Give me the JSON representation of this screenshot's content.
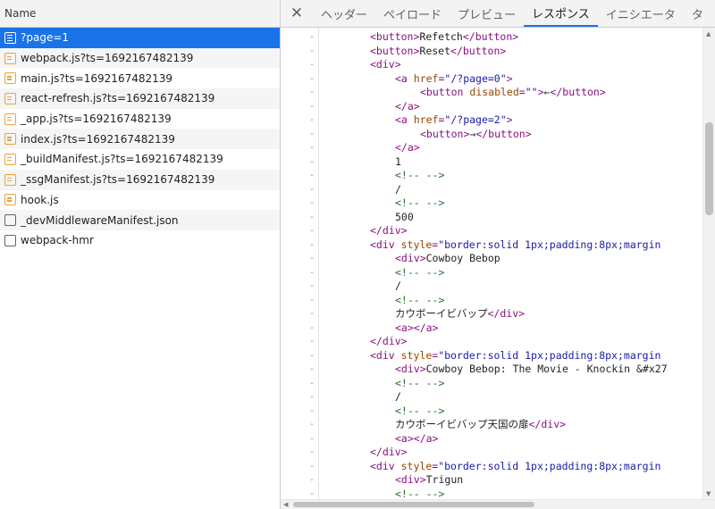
{
  "network": {
    "name_header": "Name",
    "requests": [
      {
        "label": "?page=1",
        "icon": "document-icon",
        "selected": true
      },
      {
        "label": "webpack.js?ts=1692167482139",
        "icon": "script-icon",
        "selected": false
      },
      {
        "label": "main.js?ts=1692167482139",
        "icon": "script-icon",
        "selected": false
      },
      {
        "label": "react-refresh.js?ts=1692167482139",
        "icon": "script-icon",
        "selected": false
      },
      {
        "label": "_app.js?ts=1692167482139",
        "icon": "script-icon",
        "selected": false
      },
      {
        "label": "index.js?ts=1692167482139",
        "icon": "script-icon",
        "selected": false
      },
      {
        "label": "_buildManifest.js?ts=1692167482139",
        "icon": "script-icon",
        "selected": false
      },
      {
        "label": "_ssgManifest.js?ts=1692167482139",
        "icon": "script-icon",
        "selected": false
      },
      {
        "label": "hook.js",
        "icon": "script-icon",
        "selected": false
      },
      {
        "label": "_devMiddlewareManifest.json",
        "icon": "file-icon",
        "selected": false
      },
      {
        "label": "webpack-hmr",
        "icon": "file-icon",
        "selected": false
      }
    ]
  },
  "tabs": {
    "close_glyph": "✕",
    "items": [
      {
        "label": "ヘッダー",
        "active": false
      },
      {
        "label": "ペイロード",
        "active": false
      },
      {
        "label": "プレビュー",
        "active": false
      },
      {
        "label": "レスポンス",
        "active": true
      },
      {
        "label": "イニシエータ",
        "active": false
      },
      {
        "label": "タ",
        "active": false
      }
    ]
  },
  "response": {
    "gutter_mark": "-",
    "lines": [
      {
        "indent": 8,
        "parts": [
          [
            "tag",
            "<button>"
          ],
          [
            "text",
            "Refetch"
          ],
          [
            "tag",
            "</button>"
          ]
        ]
      },
      {
        "indent": 8,
        "parts": [
          [
            "tag",
            "<button>"
          ],
          [
            "text",
            "Reset"
          ],
          [
            "tag",
            "</button>"
          ]
        ]
      },
      {
        "indent": 8,
        "parts": [
          [
            "tag",
            "<div>"
          ]
        ]
      },
      {
        "indent": 12,
        "parts": [
          [
            "tag",
            "<a "
          ],
          [
            "attr",
            "href"
          ],
          [
            "tag",
            "="
          ],
          [
            "val",
            "\"/?page=0\""
          ],
          [
            "tag",
            ">"
          ]
        ]
      },
      {
        "indent": 16,
        "parts": [
          [
            "tag",
            "<button "
          ],
          [
            "attr",
            "disabled"
          ],
          [
            "tag",
            "="
          ],
          [
            "val",
            "\"\""
          ],
          [
            "tag",
            ">"
          ],
          [
            "text",
            "←"
          ],
          [
            "tag",
            "</button>"
          ]
        ]
      },
      {
        "indent": 12,
        "parts": [
          [
            "tag",
            "</a>"
          ]
        ]
      },
      {
        "indent": 12,
        "parts": [
          [
            "tag",
            "<a "
          ],
          [
            "attr",
            "href"
          ],
          [
            "tag",
            "="
          ],
          [
            "val",
            "\"/?page=2\""
          ],
          [
            "tag",
            ">"
          ]
        ]
      },
      {
        "indent": 16,
        "parts": [
          [
            "tag",
            "<button>"
          ],
          [
            "text",
            "→"
          ],
          [
            "tag",
            "</button>"
          ]
        ]
      },
      {
        "indent": 12,
        "parts": [
          [
            "tag",
            "</a>"
          ]
        ]
      },
      {
        "indent": 12,
        "parts": [
          [
            "text",
            "1"
          ]
        ]
      },
      {
        "indent": 12,
        "parts": [
          [
            "comment",
            "<!-- -->"
          ]
        ]
      },
      {
        "indent": 12,
        "parts": [
          [
            "text",
            "/"
          ]
        ]
      },
      {
        "indent": 12,
        "parts": [
          [
            "comment",
            "<!-- -->"
          ]
        ]
      },
      {
        "indent": 12,
        "parts": [
          [
            "text",
            "500"
          ]
        ]
      },
      {
        "indent": 8,
        "parts": [
          [
            "tag",
            "</div>"
          ]
        ]
      },
      {
        "indent": 8,
        "parts": [
          [
            "tag",
            "<div "
          ],
          [
            "attr",
            "style"
          ],
          [
            "tag",
            "="
          ],
          [
            "val",
            "\"border:solid 1px;padding:8px;margin"
          ]
        ]
      },
      {
        "indent": 12,
        "parts": [
          [
            "tag",
            "<div>"
          ],
          [
            "text",
            "Cowboy Bebop"
          ]
        ]
      },
      {
        "indent": 12,
        "parts": [
          [
            "comment",
            "<!-- -->"
          ]
        ]
      },
      {
        "indent": 12,
        "parts": [
          [
            "text",
            "/"
          ]
        ]
      },
      {
        "indent": 12,
        "parts": [
          [
            "comment",
            "<!-- -->"
          ]
        ]
      },
      {
        "indent": 12,
        "parts": [
          [
            "text",
            "カウボーイビバップ"
          ],
          [
            "tag",
            "</div>"
          ]
        ]
      },
      {
        "indent": 12,
        "parts": [
          [
            "tag",
            "<a>"
          ],
          [
            "tag",
            "</a>"
          ]
        ]
      },
      {
        "indent": 8,
        "parts": [
          [
            "tag",
            "</div>"
          ]
        ]
      },
      {
        "indent": 8,
        "parts": [
          [
            "tag",
            "<div "
          ],
          [
            "attr",
            "style"
          ],
          [
            "tag",
            "="
          ],
          [
            "val",
            "\"border:solid 1px;padding:8px;margin"
          ]
        ]
      },
      {
        "indent": 12,
        "parts": [
          [
            "tag",
            "<div>"
          ],
          [
            "text",
            "Cowboy Bebop: The Movie - Knockin &#x27"
          ]
        ]
      },
      {
        "indent": 12,
        "parts": [
          [
            "comment",
            "<!-- -->"
          ]
        ]
      },
      {
        "indent": 12,
        "parts": [
          [
            "text",
            "/"
          ]
        ]
      },
      {
        "indent": 12,
        "parts": [
          [
            "comment",
            "<!-- -->"
          ]
        ]
      },
      {
        "indent": 12,
        "parts": [
          [
            "text",
            "カウボーイビバップ天国の扉"
          ],
          [
            "tag",
            "</div>"
          ]
        ]
      },
      {
        "indent": 12,
        "parts": [
          [
            "tag",
            "<a>"
          ],
          [
            "tag",
            "</a>"
          ]
        ]
      },
      {
        "indent": 8,
        "parts": [
          [
            "tag",
            "</div>"
          ]
        ]
      },
      {
        "indent": 8,
        "parts": [
          [
            "tag",
            "<div "
          ],
          [
            "attr",
            "style"
          ],
          [
            "tag",
            "="
          ],
          [
            "val",
            "\"border:solid 1px;padding:8px;margin"
          ]
        ]
      },
      {
        "indent": 12,
        "parts": [
          [
            "tag",
            "<div>"
          ],
          [
            "text",
            "Trigun"
          ]
        ]
      },
      {
        "indent": 12,
        "parts": [
          [
            "comment",
            "<!-- -->"
          ]
        ]
      }
    ]
  },
  "colors": {
    "selected_row": "#1a73e8",
    "tag": "#881280",
    "attribute": "#994500",
    "value": "#1a1aa6",
    "comment": "#236e25"
  }
}
